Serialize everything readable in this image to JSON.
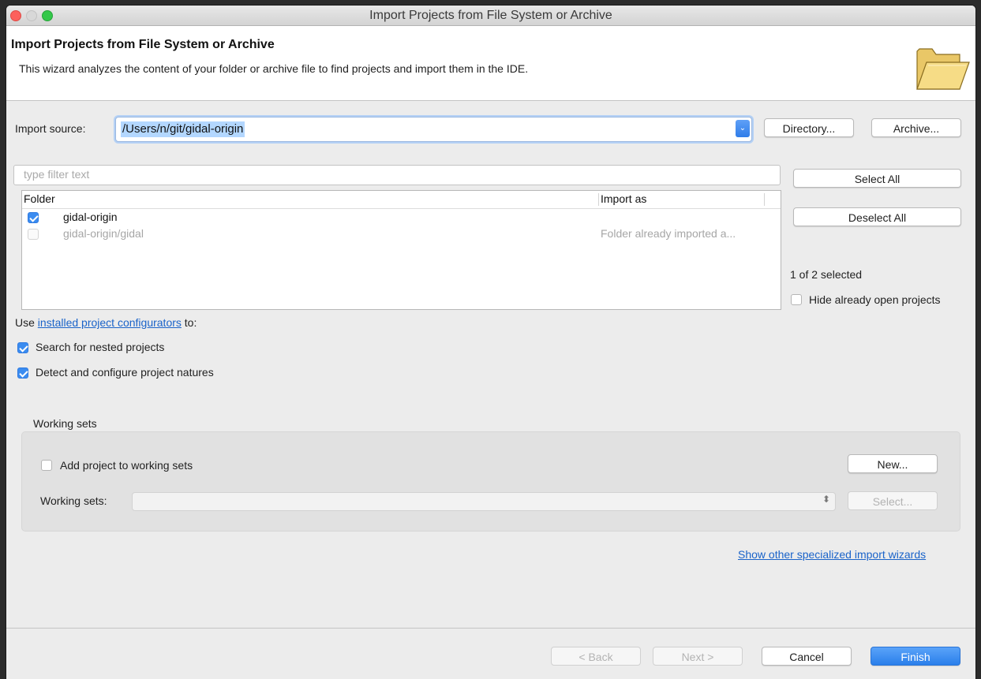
{
  "window": {
    "title": "Import Projects from File System or Archive"
  },
  "banner": {
    "title": "Import Projects from File System or Archive",
    "description": "This wizard analyzes the content of your folder or archive file to find projects and import them in the IDE."
  },
  "import_source": {
    "label": "Import source:",
    "value": "/Users/n/git/gidal-origin",
    "directory_button": "Directory...",
    "archive_button": "Archive..."
  },
  "filter": {
    "placeholder": "type filter text"
  },
  "table": {
    "columns": [
      "Folder",
      "Import as"
    ],
    "rows": [
      {
        "folder": "gidal-origin",
        "import_as": "",
        "checked": true,
        "enabled": true
      },
      {
        "folder": "gidal-origin/gidal",
        "import_as": "Folder already imported a...",
        "checked": false,
        "enabled": false
      }
    ]
  },
  "side": {
    "select_all": "Select All",
    "deselect_all": "Deselect All",
    "selection_count": "1 of 2 selected",
    "hide_open_label": "Hide already open projects"
  },
  "configurators": {
    "prefix": "Use",
    "link": "installed project configurators",
    "suffix": "to:",
    "nested_label": "Search for nested projects",
    "natures_label": "Detect and configure project natures"
  },
  "working_sets": {
    "group_title": "Working sets",
    "add_label": "Add project to working sets",
    "new_button": "New...",
    "sets_label": "Working sets:",
    "select_button": "Select..."
  },
  "other_wizards_link": "Show other specialized import wizards",
  "footer": {
    "back": "< Back",
    "next": "Next >",
    "cancel": "Cancel",
    "finish": "Finish"
  },
  "colors": {
    "accent": "#3b8cf0",
    "link": "#1a63c9"
  }
}
